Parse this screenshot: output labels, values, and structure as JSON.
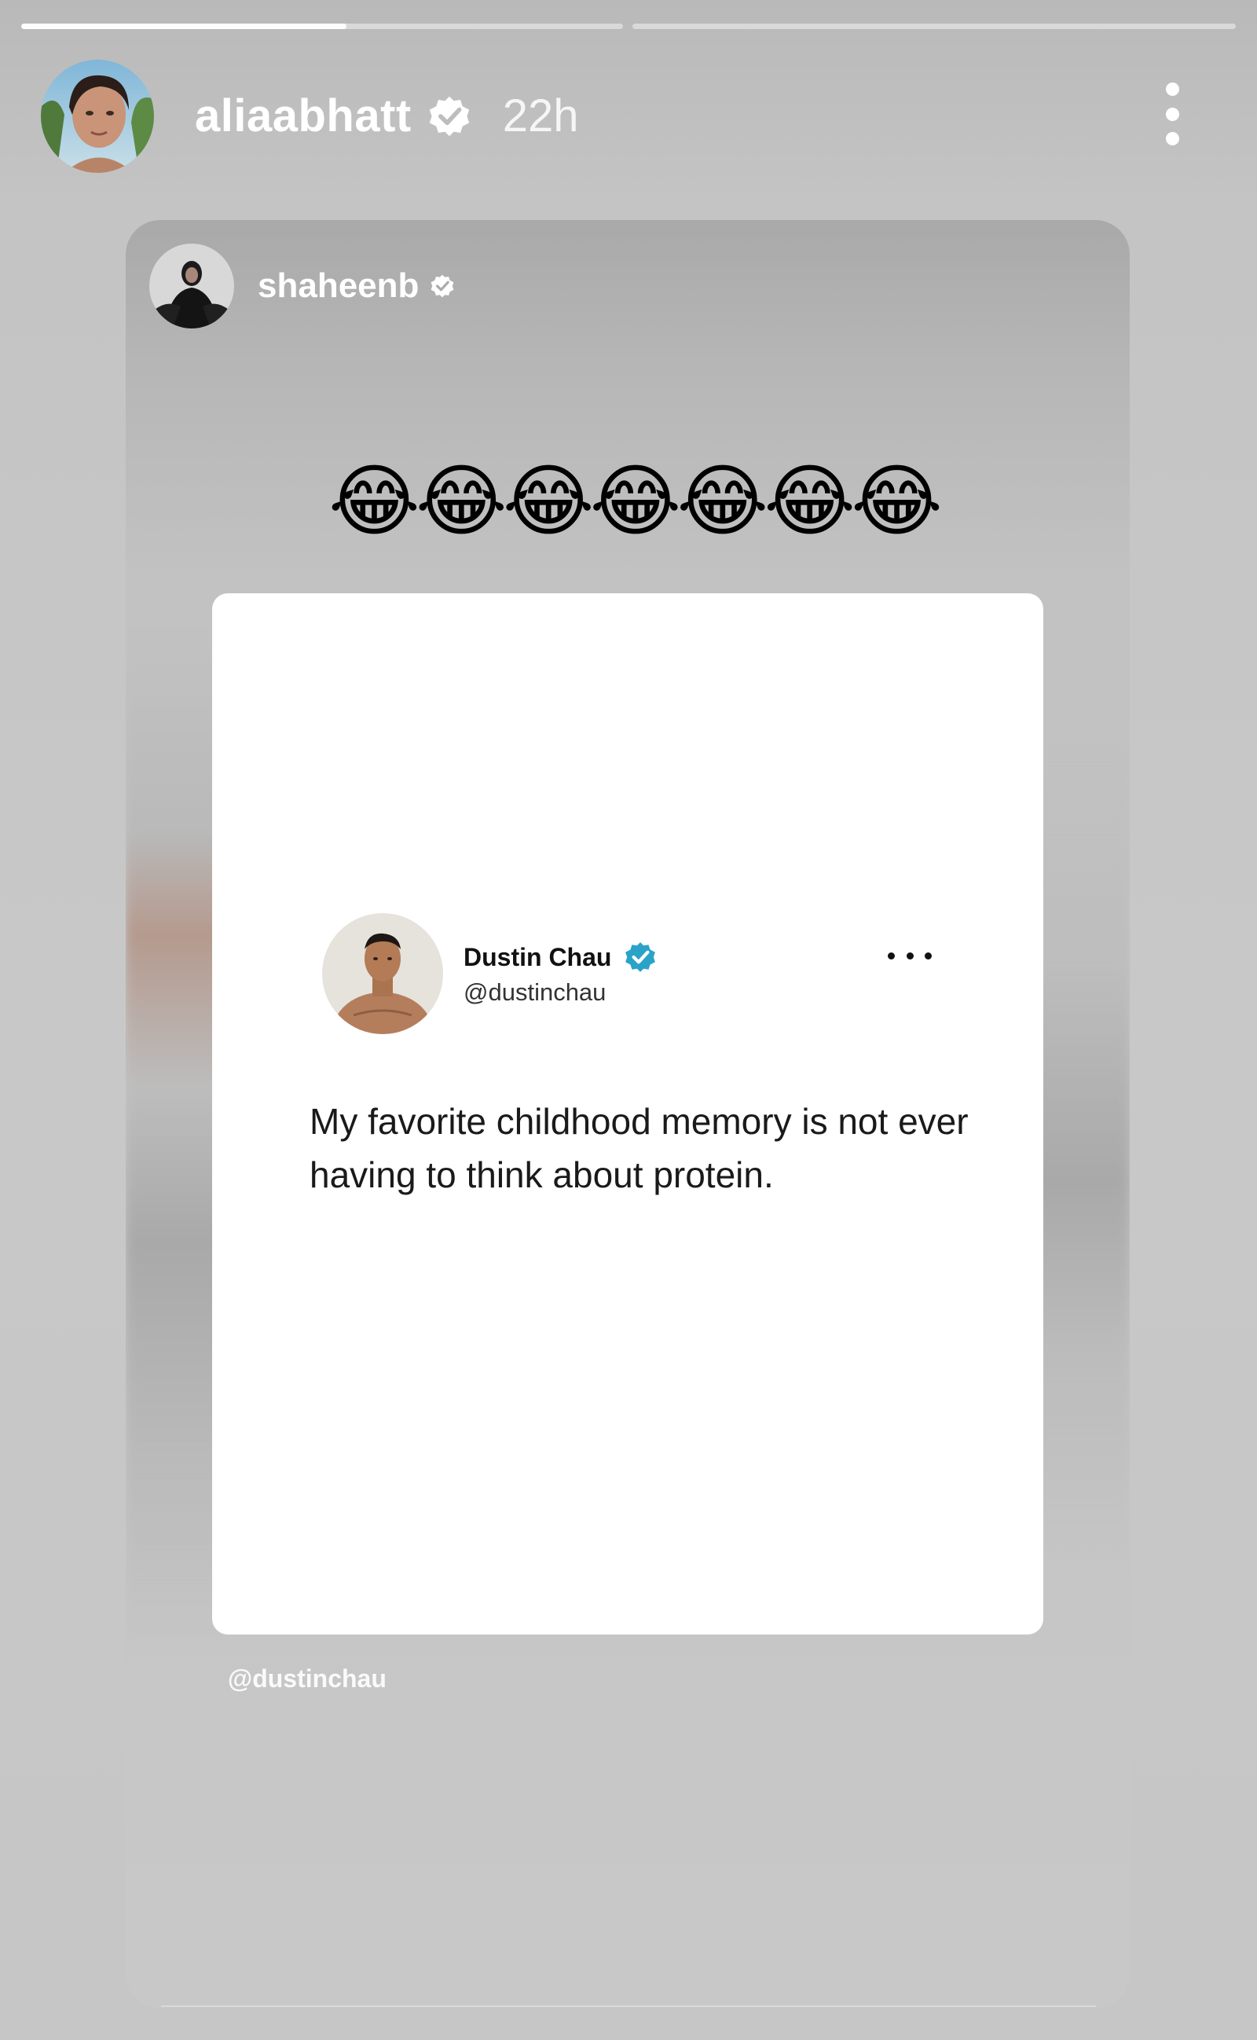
{
  "progress": {
    "segments": [
      {
        "filled": 0.54
      },
      {
        "filled": 0
      },
      {
        "filled": 0
      }
    ]
  },
  "header": {
    "username": "aliaabhatt",
    "verified": true,
    "time": "22h"
  },
  "shared_post": {
    "username": "shaheenb",
    "verified": true,
    "emojis": "😂😂😂😂😂😂😂",
    "mention": "@dustinchau"
  },
  "tweet": {
    "name": "Dustin Chau",
    "handle": "@dustinchau",
    "verified": true,
    "text": "My favorite childhood memory is not ever having to think about protein."
  },
  "colors": {
    "verified_blue": "#1d9bf0",
    "background": "#c6c6c6",
    "card": "#ffffff"
  }
}
